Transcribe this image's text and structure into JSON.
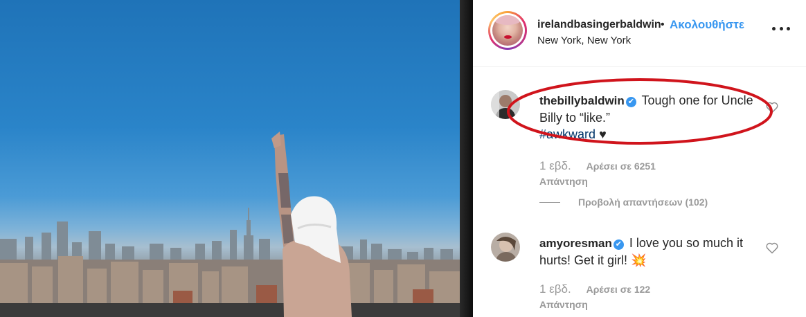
{
  "post": {
    "username": "irelandbasingerbaldwin",
    "separator": "•",
    "follow_label": "Ακολουθήστε",
    "location": "New York, New York"
  },
  "comments": [
    {
      "username": "thebillybaldwin",
      "text": "Tough one for Uncle Billy to “like.”",
      "hashtag": "#awkward",
      "emoji": "♥",
      "time": "1 εβδ.",
      "likes": "Αρέσει σε 6251",
      "reply": "Απάντηση",
      "view_replies": "Προβολή απαντήσεων (102)"
    },
    {
      "username": "amyoresman",
      "text": "I love you so much it hurts! Get it girl!",
      "emoji": "💥",
      "time": "1 εβδ.",
      "likes": "Αρέσει σε 122",
      "reply": "Απάντηση"
    }
  ],
  "icons": {
    "verified": "✔",
    "heart": "heart-outline-icon",
    "more": "more-options-icon"
  },
  "colors": {
    "link_blue": "#3897f0",
    "highlight_red": "#d0141c",
    "text": "#262626",
    "muted": "#999999"
  }
}
